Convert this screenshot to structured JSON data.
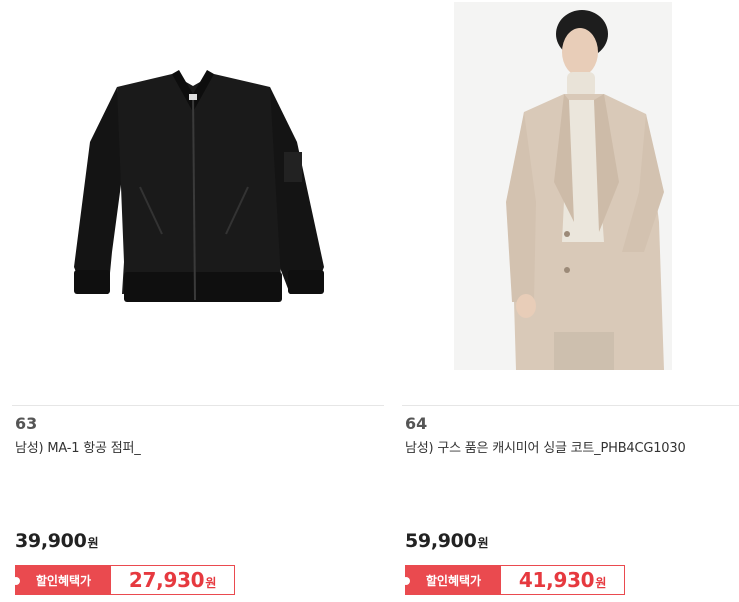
{
  "products": [
    {
      "rank": "63",
      "name": "남성) MA-1 항공 점퍼_",
      "price": "39,900",
      "currency": "원",
      "benefit_label": "할인혜택가",
      "discount_price": "27,930",
      "image_icon": "bomber-jacket-image"
    },
    {
      "rank": "64",
      "name": "남성) 구스 품은 캐시미어 싱글 코트_PHB4CG1030",
      "price": "59,900",
      "currency": "원",
      "benefit_label": "할인혜택가",
      "discount_price": "41,930",
      "image_icon": "wool-coat-model-image"
    }
  ],
  "colors": {
    "accent": "#ea4a4f",
    "discount_text": "#e6393f",
    "divider": "#e6e6e6"
  }
}
